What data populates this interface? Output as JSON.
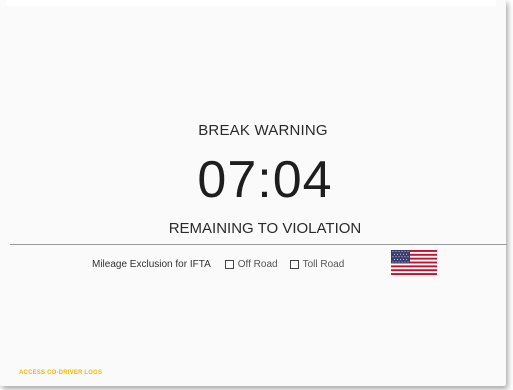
{
  "warning": {
    "title": "BREAK WARNING",
    "timer": "07:04",
    "subtitle": "REMAINING TO VIOLATION"
  },
  "ifta": {
    "label": "Mileage Exclusion for IFTA",
    "options": [
      {
        "label": "Off Road",
        "checked": false
      },
      {
        "label": "Toll Road",
        "checked": false
      }
    ],
    "flag_icon": "us-flag-icon"
  },
  "footer": {
    "link": "ACCESS CO-DRIVER LOGS"
  },
  "colors": {
    "footer_link": "#f0b800",
    "flag_red": "#c8102e",
    "flag_blue": "#3c3b6e"
  }
}
